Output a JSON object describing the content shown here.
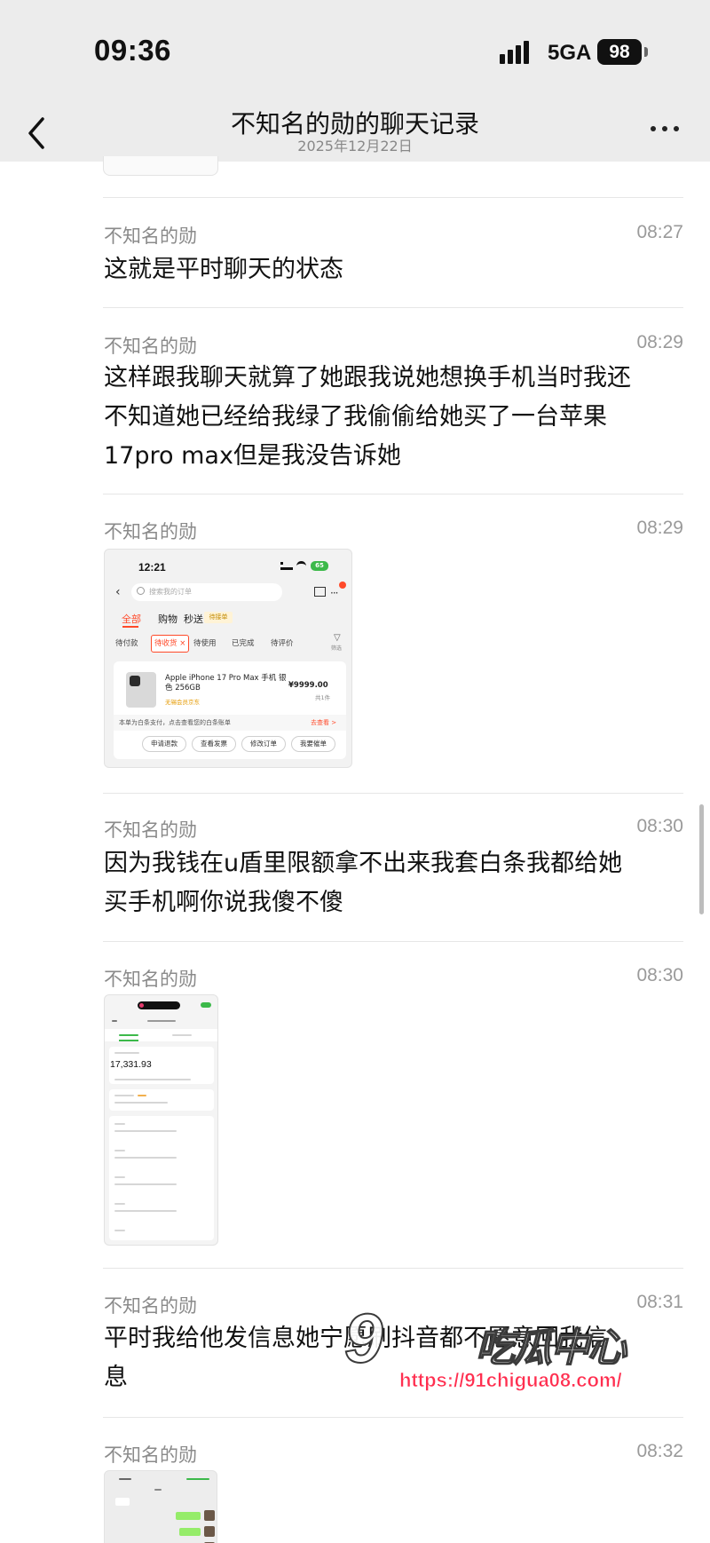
{
  "status_bar": {
    "time": "09:36",
    "network": "5GA",
    "battery": "98"
  },
  "header": {
    "title": "不知名的勋的聊天记录",
    "date": "2025年12月22日"
  },
  "messages": [
    {
      "sender": "不知名的勋",
      "time": "08:27",
      "lines": [
        "这就是平时聊天的状态"
      ]
    },
    {
      "sender": "不知名的勋",
      "time": "08:29",
      "lines": [
        "这样跟我聊天就算了她跟我说她想换手机当时我还",
        "不知道她已经给我绿了我偷偷给她买了一台苹果",
        "17pro max但是我没告诉她"
      ]
    },
    {
      "sender": "不知名的勋",
      "time": "08:29",
      "image": "order-screenshot"
    },
    {
      "sender": "不知名的勋",
      "time": "08:30",
      "lines": [
        "因为我钱在u盾里限额拿不出来我套白条我都给她",
        "买手机啊你说我傻不傻"
      ]
    },
    {
      "sender": "不知名的勋",
      "time": "08:30",
      "image": "bill-screenshot"
    },
    {
      "sender": "不知名的勋",
      "time": "08:31",
      "lines": [
        "平时我给他发信息她宁愿刷抖音都不愿意回我信",
        "息"
      ]
    },
    {
      "sender": "不知名的勋",
      "time": "08:32",
      "image": "chat-screenshot"
    }
  ],
  "order_shot": {
    "time": "12:21",
    "battery": "65",
    "search_placeholder": "搜索我的订单",
    "tabs": [
      "全部",
      "购物",
      "秒送"
    ],
    "tag": "待接单",
    "chips": [
      "待付款",
      "待收货 ×",
      "待使用",
      "已完成",
      "待评价"
    ],
    "filter_label": "筛选",
    "product_name": "Apple iPhone 17 Pro Max 手机 银色 256GB",
    "product_tag": "无锡会员京东",
    "price": "¥9999.00",
    "qty": "共1件",
    "notice": "本单为白条支付，点击查看您的白条账单",
    "notice_link": "去查看 >",
    "buttons": [
      "申请退款",
      "查看发票",
      "修改订单",
      "我要催单"
    ]
  },
  "bill_shot": {
    "amount": "17,331.93"
  },
  "watermark": {
    "logo": "9",
    "text": "吃瓜中心",
    "url": "https://91chigua08.com/"
  }
}
